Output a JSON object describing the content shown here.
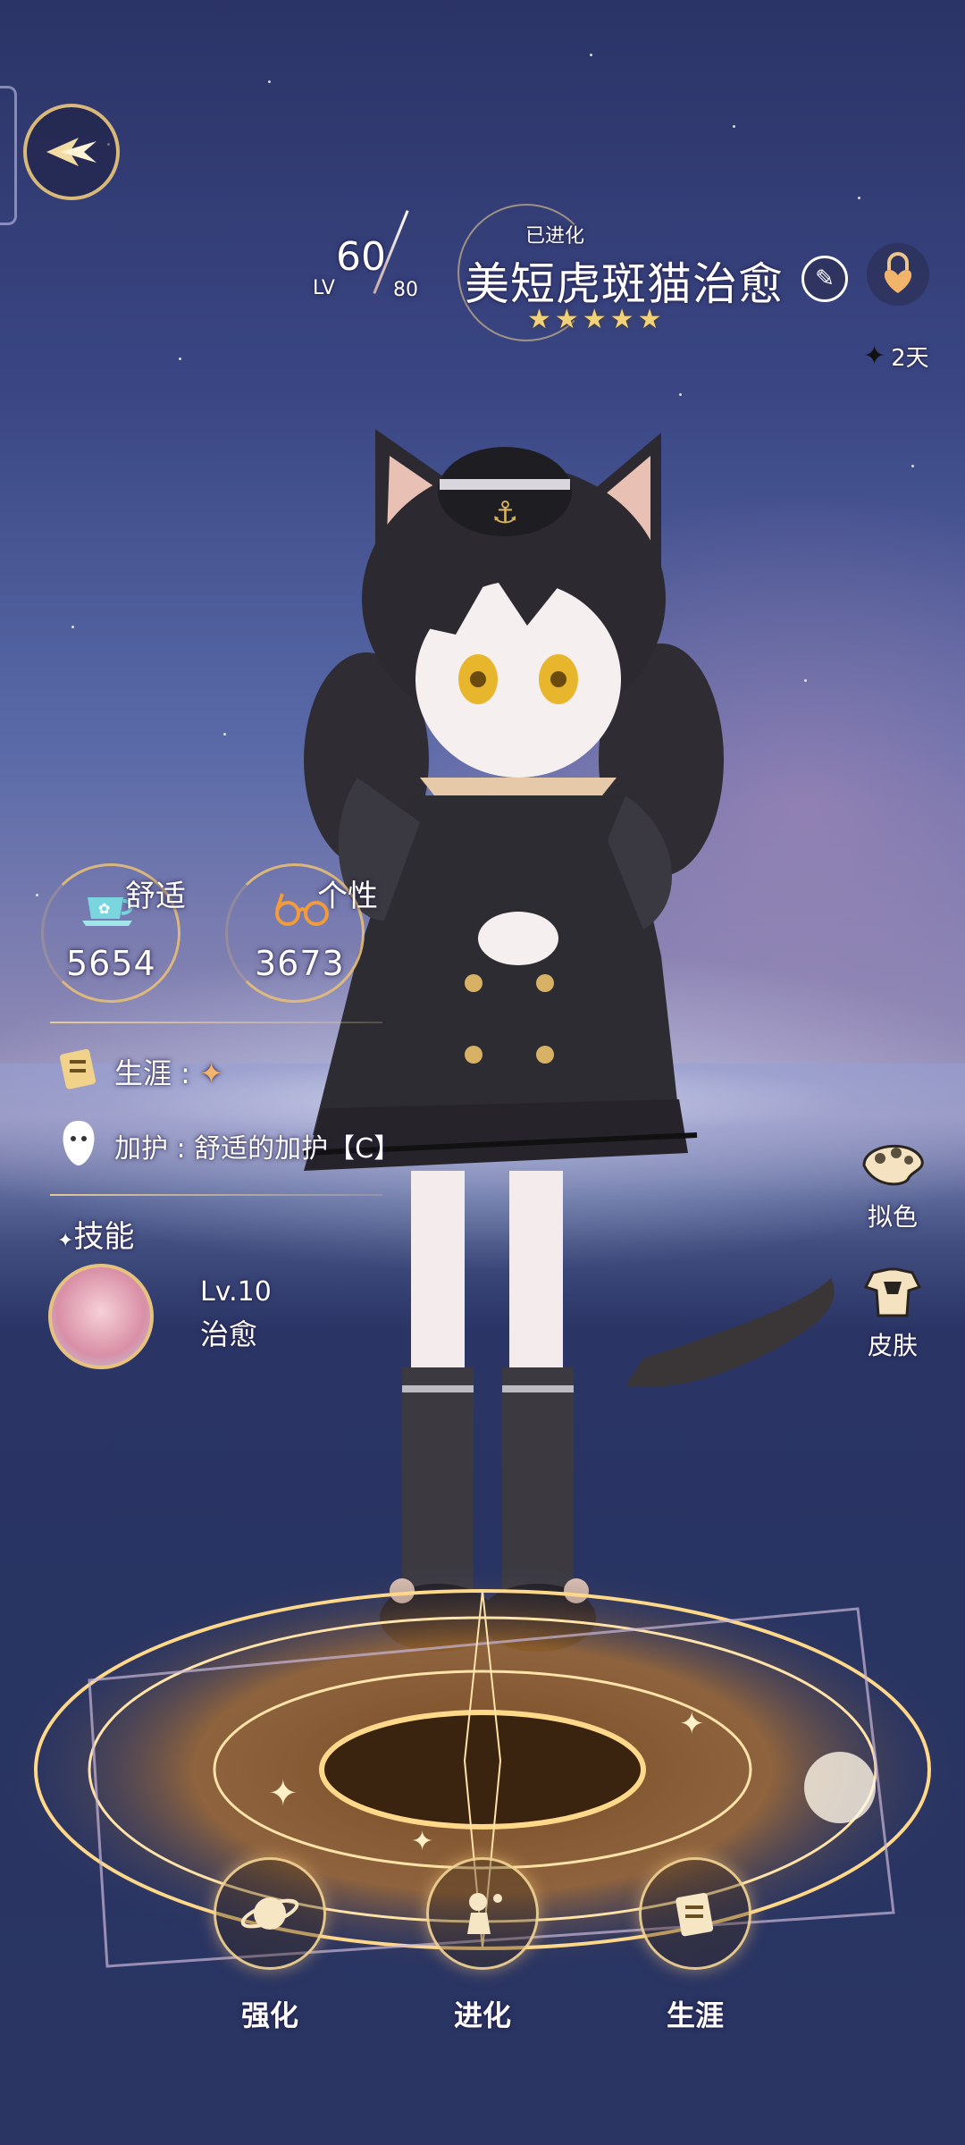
{
  "header": {
    "level_label": "LV",
    "level_value": "60",
    "level_max": "80",
    "evolved_tag": "已进化",
    "character_name": "美短虎斑猫治愈",
    "rarity_stars": "★★★★★",
    "timer_text": "2天"
  },
  "stats": {
    "comfort": {
      "label": "舒适",
      "value": "5654"
    },
    "personality": {
      "label": "个性",
      "value": "3673"
    }
  },
  "info": {
    "career_label": "生涯 :",
    "protection_label": "加护 : 舒适的加护【C】"
  },
  "skill": {
    "header": "技能",
    "level": "Lv.10",
    "name": "治愈"
  },
  "side_buttons": {
    "dye": "拟色",
    "skin": "皮肤"
  },
  "bottom_buttons": {
    "strengthen": "强化",
    "evolve": "进化",
    "career": "生涯"
  },
  "colors": {
    "accent_gold": "#e7c27f",
    "sky_top": "#2b3466",
    "text": "#ffffff"
  }
}
